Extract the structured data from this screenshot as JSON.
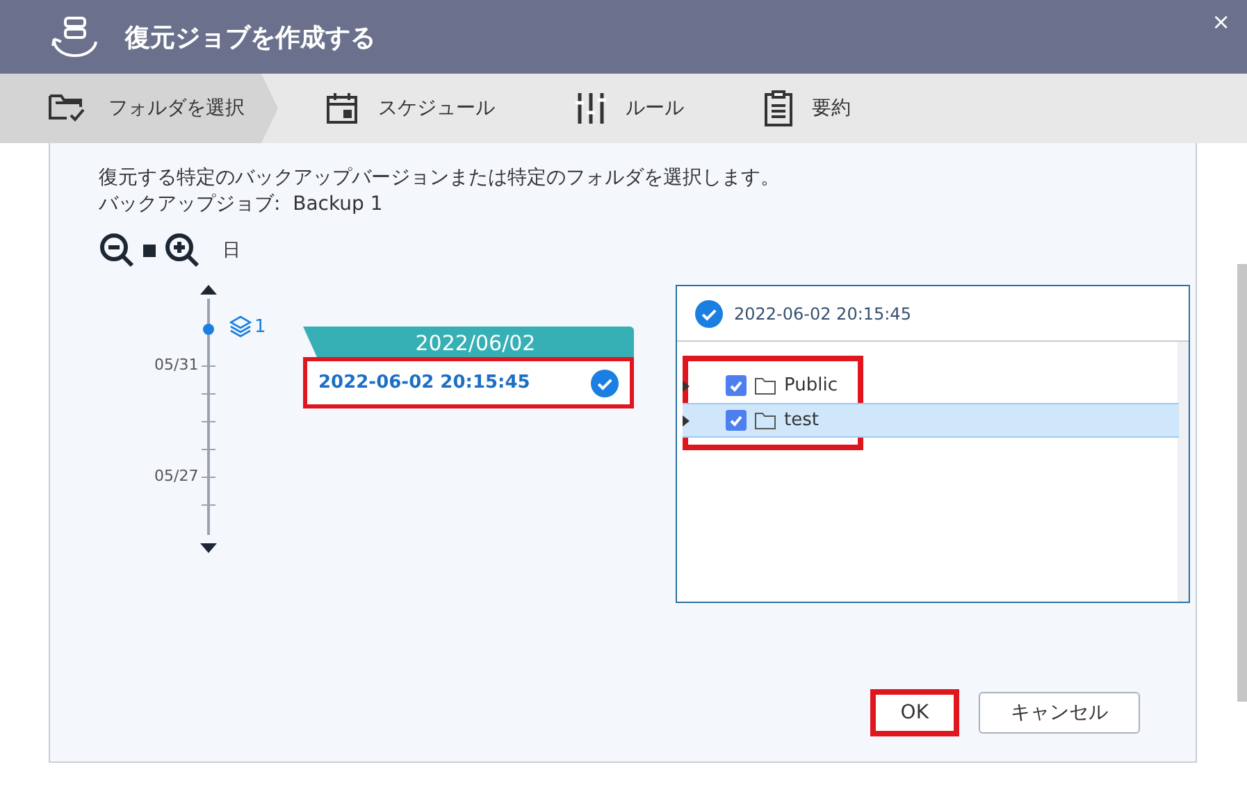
{
  "window": {
    "title": "復元ジョブを作成する",
    "close": "×"
  },
  "steps": [
    {
      "label": "フォルダを選択",
      "kind": "folder",
      "selected": true
    },
    {
      "label": "スケジュール",
      "kind": "calendar",
      "selected": false
    },
    {
      "label": "ルール",
      "kind": "sliders",
      "selected": false
    },
    {
      "label": "要約",
      "kind": "clipboard",
      "selected": false
    }
  ],
  "description": "復元する特定のバックアップバージョンまたは特定のフォルダを選択します。",
  "backup_job": "バックアップジョブ:  Backup 1",
  "zoom": {
    "unit": "日"
  },
  "timeline": {
    "version_count": "1",
    "labels": [
      "05/31",
      "05/27"
    ]
  },
  "version_group": {
    "date": "2022/06/02",
    "versions": [
      {
        "time": "2022-06-02 20:15:45",
        "selected": true,
        "highlighted": true
      }
    ]
  },
  "folder_panel": {
    "version": "2022-06-02 20:15:45",
    "items": [
      {
        "name": "Public",
        "checked": true,
        "selected": false
      },
      {
        "name": "test",
        "checked": true,
        "selected": true
      }
    ]
  },
  "buttons": [
    {
      "label": "OK",
      "kind": "primary",
      "highlighted": true
    },
    {
      "label": "キャンセル",
      "kind": "secondary",
      "highlighted": false
    }
  ]
}
